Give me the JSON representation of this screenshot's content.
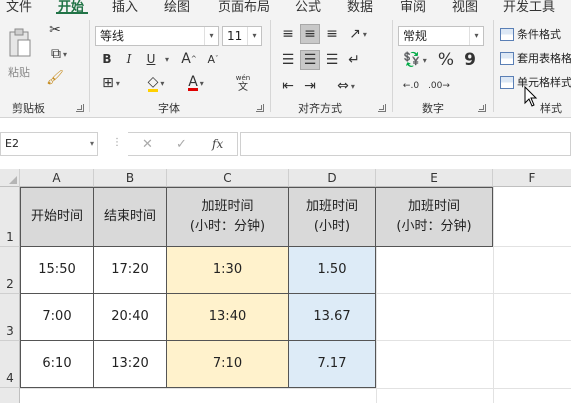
{
  "ribbon": {
    "tabs": [
      "文件",
      "开始",
      "插入",
      "绘图",
      "页面布局",
      "公式",
      "数据",
      "审阅",
      "视图",
      "开发工具"
    ],
    "active_tab": "开始",
    "clipboard": {
      "paste_label": "粘贴",
      "group_label": "剪贴板"
    },
    "font": {
      "font_name": "等线",
      "font_size": "11",
      "group_label": "字体",
      "bold": "B",
      "italic": "I",
      "underline": "U",
      "grow": "A",
      "shrink": "A",
      "font_color": "A",
      "phonetic_top": "wén",
      "phonetic_bottom": "文"
    },
    "alignment": {
      "group_label": "对齐方式"
    },
    "number": {
      "format": "常规",
      "percent": "%",
      "comma": "9",
      "group_label": "数字"
    },
    "styles": {
      "conditional": "条件格式",
      "table_format": "套用表格格式",
      "cell_styles": "单元格样式",
      "group_label": "样式"
    }
  },
  "formula_bar": {
    "name_box": "E2",
    "fx": "fx",
    "cancel": "✕",
    "confirm": "✓",
    "value": ""
  },
  "sheet": {
    "columns": [
      "A",
      "B",
      "C",
      "D",
      "E",
      "F"
    ],
    "rows": [
      "1",
      "2",
      "3",
      "4"
    ],
    "headers": [
      "开始时间",
      "结束时间",
      "加班时间\n(小时：分钟)",
      "加班时间\n(小时)",
      "加班时间\n(小时：分钟)"
    ],
    "data": [
      [
        "15:50",
        "17:20",
        "1:30",
        "1.50"
      ],
      [
        "7:00",
        "20:40",
        "13:40",
        "13.67"
      ],
      [
        "6:10",
        "13:20",
        "7:10",
        "7.17"
      ]
    ]
  },
  "colors": {
    "accent": "#217346",
    "header_fill": "#d9d9d9",
    "yellow_fill": "#fff2cc",
    "blue_fill": "#ddebf7"
  }
}
